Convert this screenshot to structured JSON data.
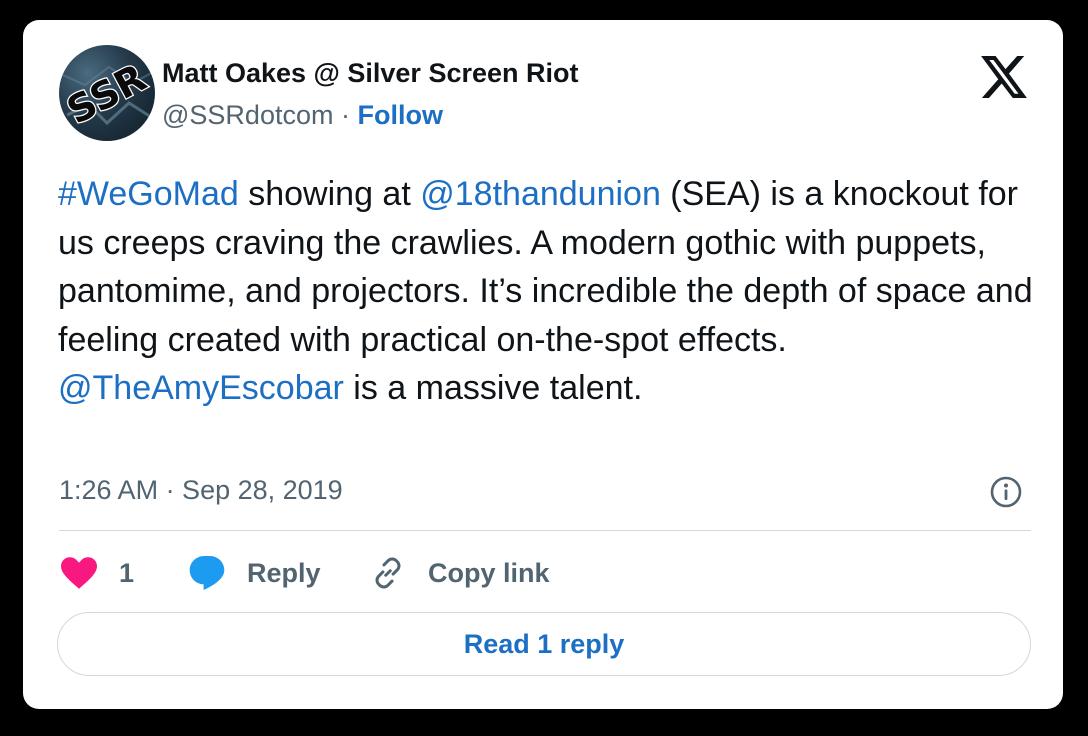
{
  "author": {
    "display_name": "Matt Oakes @ Silver Screen Riot",
    "handle": "@SSRdotcom",
    "separator": "·",
    "follow_label": "Follow",
    "avatar_text": "SSR"
  },
  "tweet": {
    "segments": [
      {
        "text": "#WeGoMad",
        "type": "link"
      },
      {
        "text": " showing at ",
        "type": "text"
      },
      {
        "text": "@18thandunion",
        "type": "link"
      },
      {
        "text": " (SEA) is a knockout for us creeps craving the crawlies. A modern gothic with puppets, pantomime, and projectors. It’s incredible the depth of space and feeling created with practical on-the-spot effects. ",
        "type": "text"
      },
      {
        "text": "@TheAmyEscobar",
        "type": "link"
      },
      {
        "text": " is a massive talent.",
        "type": "text"
      }
    ],
    "timestamp": "1:26 AM · Sep 28, 2019"
  },
  "actions": {
    "like_count": "1",
    "reply_label": "Reply",
    "copy_link_label": "Copy link",
    "read_replies_label": "Read 1 reply"
  },
  "icons": {
    "logo": "x-logo-icon",
    "info": "info-icon",
    "like": "heart-icon",
    "reply": "speech-bubble-icon",
    "copy": "link-icon"
  },
  "colors": {
    "link": "#1d6fc4",
    "heart": "#f91880",
    "reply_bubble": "#1d9bf0",
    "text_primary": "#0f1419",
    "text_secondary": "#536471",
    "border": "#cfd9de",
    "page_background": "#000000",
    "card_background": "#ffffff"
  }
}
